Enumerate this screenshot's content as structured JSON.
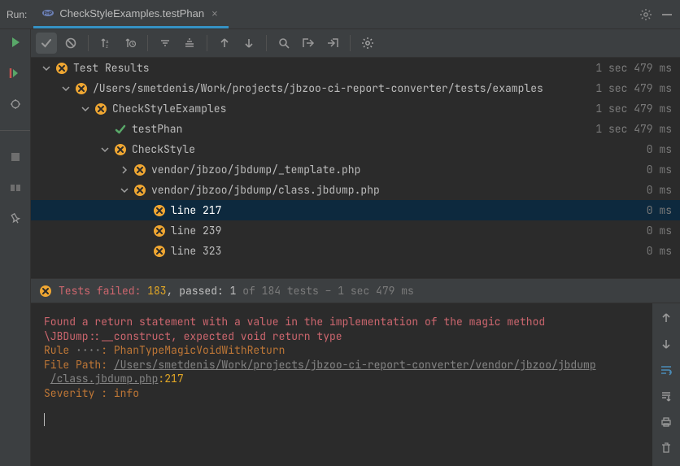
{
  "header": {
    "run_label": "Run:",
    "tab_title": "CheckStyleExamples.testPhan"
  },
  "tree": [
    {
      "indent": 0,
      "chev": "down",
      "status": "fail",
      "label": "Test Results",
      "time": "1 sec 479 ms",
      "sel": false
    },
    {
      "indent": 1,
      "chev": "down",
      "status": "fail",
      "label": "/Users/smetdenis/Work/projects/jbzoo-ci-report-converter/tests/examples",
      "time": "1 sec 479 ms",
      "sel": false
    },
    {
      "indent": 2,
      "chev": "down",
      "status": "fail",
      "label": "CheckStyleExamples",
      "time": "1 sec 479 ms",
      "sel": false
    },
    {
      "indent": 3,
      "chev": "none",
      "status": "pass",
      "label": "testPhan",
      "time": "1 sec 479 ms",
      "sel": false
    },
    {
      "indent": 3,
      "chev": "down",
      "status": "fail",
      "label": "CheckStyle",
      "time": "0 ms",
      "sel": false
    },
    {
      "indent": 4,
      "chev": "right",
      "status": "fail",
      "label": "vendor/jbzoo/jbdump/_template.php",
      "time": "0 ms",
      "sel": false
    },
    {
      "indent": 4,
      "chev": "down",
      "status": "fail",
      "label": "vendor/jbzoo/jbdump/class.jbdump.php",
      "time": "0 ms",
      "sel": false
    },
    {
      "indent": 5,
      "chev": "none",
      "status": "fail",
      "label": "line 217",
      "time": "0 ms",
      "sel": true
    },
    {
      "indent": 5,
      "chev": "none",
      "status": "fail",
      "label": "line 239",
      "time": "0 ms",
      "sel": false
    },
    {
      "indent": 5,
      "chev": "none",
      "status": "fail",
      "label": "line 323",
      "time": "0 ms",
      "sel": false
    }
  ],
  "summary": {
    "prefix": "Tests failed: ",
    "failed": "183",
    "middle": ", passed: ",
    "passed": "1",
    "rest": " of 184 tests – 1 sec 479 ms"
  },
  "console": {
    "msg1": "Found a return statement with a value in the implementation of the magic method",
    "msg2": " \\JBDump::__construct, expected void return type",
    "rule_label": "Rule ",
    "rule_dots": "····",
    "rule_sep": ": ",
    "rule_value": "PhanTypeMagicVoidWithReturn",
    "fp_label": "File Path: ",
    "fp_link1": "/Users/smetdenis/Work/projects/jbzoo-ci-report-converter/vendor/jbzoo/jbdump",
    "fp_link2": "/class.jbdump.php",
    "fp_sep": ":",
    "fp_line": "217",
    "sev_label": "Severity : ",
    "sev_value": "info"
  }
}
